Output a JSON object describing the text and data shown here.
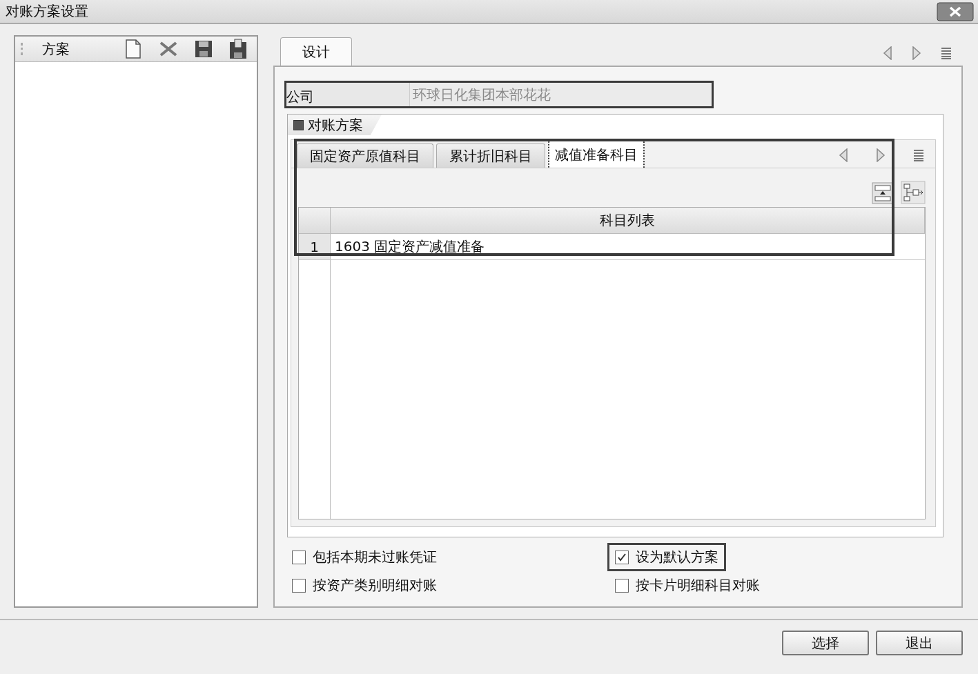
{
  "window": {
    "title": "对账方案设置"
  },
  "scheme_panel": {
    "title": "方案"
  },
  "design_tab": {
    "label": "设计",
    "selected": true
  },
  "company": {
    "label": "公司",
    "value": "环球日化集团本部花花",
    "highlighted": true
  },
  "scheme_group": {
    "title": "对账方案"
  },
  "account_tabs_highlighted": true,
  "account_tabs": [
    {
      "label": "固定资产原值科目",
      "selected": false
    },
    {
      "label": "累计折旧科目",
      "selected": false
    },
    {
      "label": "减值准备科目",
      "selected": true
    }
  ],
  "grid": {
    "columns": [
      "科目列表"
    ],
    "rows": [
      {
        "number": "1",
        "account": "1603 固定资产减值准备"
      }
    ]
  },
  "options": [
    {
      "label": "包括本期未过账凭证",
      "checked": false,
      "highlighted": false
    },
    {
      "label": "设为默认方案",
      "checked": true,
      "highlighted": true
    },
    {
      "label": "按资产类别明细对账",
      "checked": false,
      "highlighted": false
    },
    {
      "label": "按卡片明细科目对账",
      "checked": false,
      "highlighted": false
    }
  ],
  "buttons": [
    "选择",
    "退出"
  ]
}
